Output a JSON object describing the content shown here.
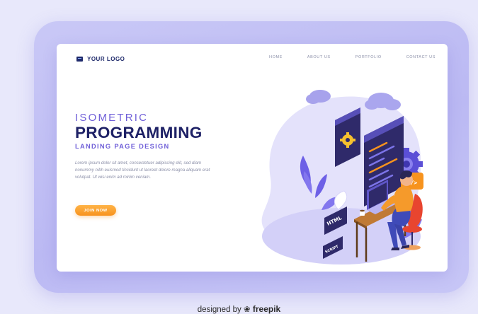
{
  "header": {
    "logo_text": "YOUR LOGO",
    "nav": [
      "HOME",
      "ABOUT US",
      "PORTFOLIO",
      "CONTACT US"
    ]
  },
  "hero": {
    "title_small": "ISOMETRIC",
    "title_main": "PROGRAMMING",
    "title_sub": "LANDING PAGE DESIGN",
    "body": "Lorem ipsum dolor sit amet, consectetuer adipiscing elit, sed diam nonummy nibh euismod tincidunt ut laoreet dolore magna aliquam erat volutpat. Ut wisi enim ad minim veniam.",
    "cta_label": "JOIN NOW"
  },
  "illustration": {
    "tag_html": "HTML",
    "tag_script": "SCRIPT",
    "code_symbol": "</>"
  },
  "footer": {
    "credit_prefix": "designed by",
    "credit_brand": "freepik"
  },
  "colors": {
    "accent_purple": "#6f5fd8",
    "navy": "#1e2166",
    "orange": "#f7931e",
    "background": "#e8e8fb"
  }
}
